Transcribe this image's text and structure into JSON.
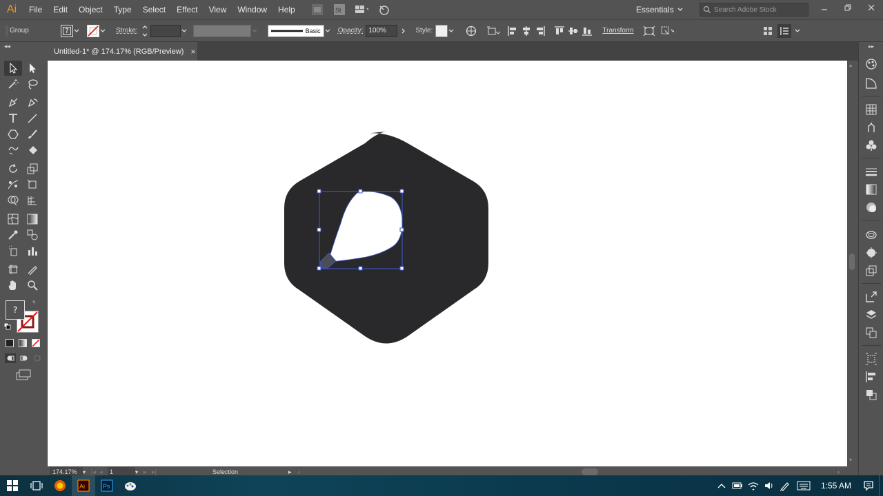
{
  "app": {
    "logo": "Ai",
    "accent": "#f7931e"
  },
  "menus": [
    "File",
    "Edit",
    "Object",
    "Type",
    "Select",
    "Effect",
    "View",
    "Window",
    "Help"
  ],
  "workspace": {
    "label": "Essentials"
  },
  "search": {
    "placeholder": "Search Adobe Stock"
  },
  "control": {
    "selection_type": "Group",
    "fill_value": "?",
    "stroke_label": "Stroke:",
    "stroke_style": "Basic",
    "opacity_label": "Opacity:",
    "opacity_value": "100%",
    "style_label": "Style:",
    "transform_label": "Transform"
  },
  "document": {
    "tab_title": "Untitled-1* @ 174.17% (RGB/Preview)",
    "close": "×"
  },
  "toolbar": {
    "fill_unknown": "?"
  },
  "artwork": {
    "hexagon_color": "#29282b",
    "bulb_color": "#ffffff",
    "base_color": "#4a4d5a",
    "selection_color": "#3d5bd6"
  },
  "status": {
    "zoom": "174.17%",
    "artboard": "1",
    "tool": "Selection"
  },
  "taskbar": {
    "time": "1:55 AM"
  }
}
